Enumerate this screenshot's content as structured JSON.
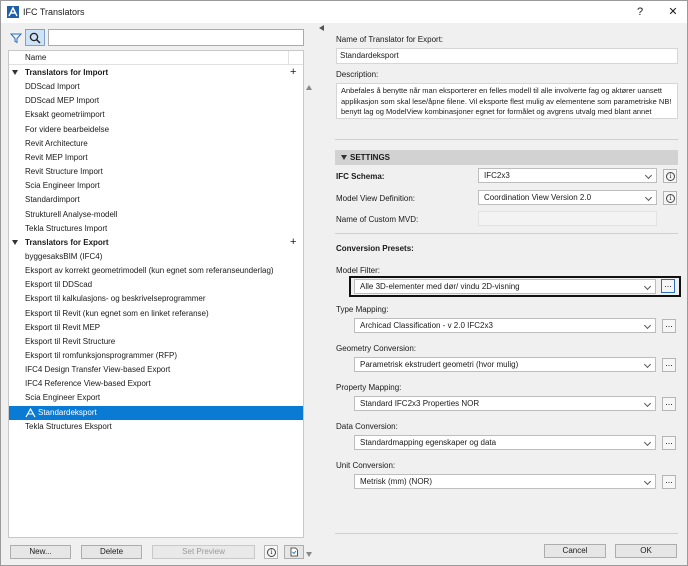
{
  "window": {
    "title": "IFC Translators",
    "help": "?",
    "close": "✕"
  },
  "left": {
    "column_header": "Name",
    "groups": [
      {
        "label": "Translators for Import",
        "items": [
          "DDScad Import",
          "DDScad MEP Import",
          "Eksakt geometriimport",
          "For videre bearbeidelse",
          "Revit Architecture",
          "Revit MEP Import",
          "Revit Structure Import",
          "Scia Engineer Import",
          "Standardimport",
          "Strukturell Analyse-modell",
          "Tekla Structures Import"
        ]
      },
      {
        "label": "Translators for Export",
        "items": [
          "byggesaksBIM (IFC4)",
          "Eksport av korrekt geometrimodell (kun egnet som referanseunderlag)",
          "Eksport til DDScad",
          "Eksport til kalkulasjons- og beskrivelseprogrammer",
          "Eksport til Revit (kun egnet som en linket referanse)",
          "Eksport til Revit MEP",
          "Eksport til Revit Structure",
          "Eksport til romfunksjonsprogrammer (RFP)",
          "IFC4 Design Transfer View-based Export",
          "IFC4 Reference View-based Export",
          "Scia Engineer Export",
          "Standardeksport",
          "Tekla Structures Eksport"
        ]
      }
    ],
    "buttons": {
      "new": "New...",
      "delete": "Delete",
      "set_preview": "Set Preview"
    }
  },
  "right": {
    "name_label": "Name of Translator for Export:",
    "name_value": "Standardeksport",
    "desc_label": "Description:",
    "desc_text": "Anbefales å benytte når man eksporterer en felles modell til alle involverte fag og aktører uansett applikasjon som skal lese/åpne filene. Vil eksporte flest mulig av elementene som parametriske NB! benytt lag og ModelView kombinasjoner egnet for formålet og avgrens utvalg med blant annet Versjon til IFC for 3D-vindu",
    "settings_label": "SETTINGS",
    "ifc_schema_label": "IFC Schema:",
    "ifc_schema_value": "IFC2x3",
    "mvd_label": "Model View Definition:",
    "mvd_value": "Coordination View Version 2.0",
    "custom_mvd_label": "Name of Custom MVD:",
    "presets_label": "Conversion Presets:",
    "model_filter_label": "Model Filter:",
    "model_filter_value": "Alle 3D-elementer med dør/ vindu 2D-visning",
    "type_mapping_label": "Type Mapping:",
    "type_mapping_value": "Archicad Classification - v 2.0 IFC2x3",
    "geometry_label": "Geometry Conversion:",
    "geometry_value": "Parametrisk ekstrudert geometri (hvor mulig)",
    "property_label": "Property Mapping:",
    "property_value": "Standard IFC2x3 Properties NOR",
    "data_label": "Data Conversion:",
    "data_value": "Standardmapping egenskaper og data",
    "unit_label": "Unit Conversion:",
    "unit_value": "Metrisk (mm) (NOR)",
    "dots": "...",
    "info_glyph": "i",
    "cancel": "Cancel",
    "ok": "OK"
  }
}
